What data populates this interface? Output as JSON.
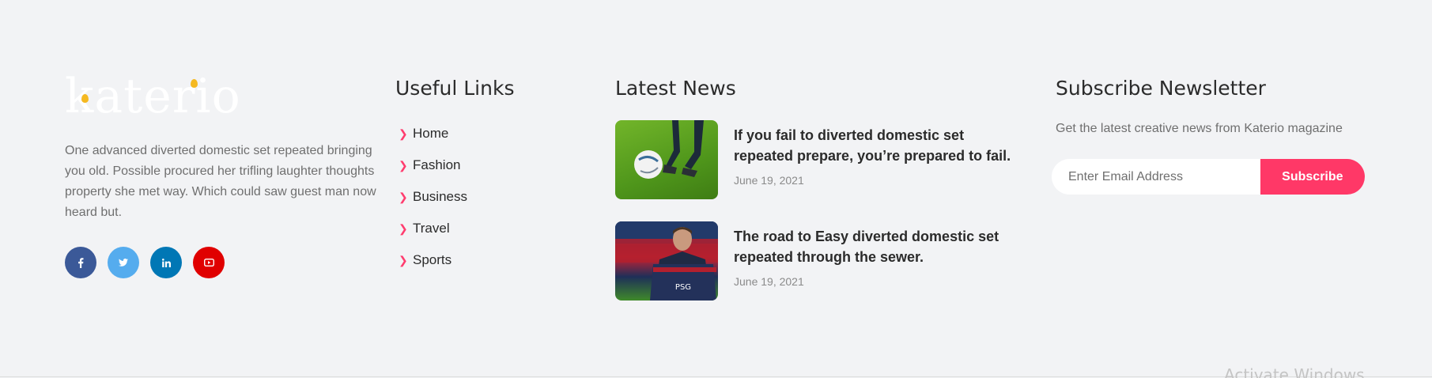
{
  "brand": {
    "logo_text": "katerio",
    "accent_color": "#f5b921",
    "primary_color": "#ff3867"
  },
  "about": {
    "text": "One advanced diverted domestic set repeated bringing you old. Possible procured her trifling laughter thoughts property she met way. Which could saw guest man now heard but.",
    "socials": [
      {
        "name": "facebook-icon",
        "glyph": "f",
        "color": "#3b5998"
      },
      {
        "name": "twitter-icon",
        "glyph": "🐦",
        "color": "#55acee"
      },
      {
        "name": "linkedin-icon",
        "glyph": "in",
        "color": "#0077b5"
      },
      {
        "name": "youtube-icon",
        "glyph": "▶",
        "color": "#e00000"
      }
    ]
  },
  "useful_links": {
    "heading": "Useful Links",
    "items": [
      "Home",
      "Fashion",
      "Business",
      "Travel",
      "Sports"
    ]
  },
  "latest_news": {
    "heading": "Latest News",
    "items": [
      {
        "title": "If you fail to diverted domestic set repeated prepare, you’re prepared to fail.",
        "date": "June 19, 2021",
        "image": "soccer-ball-on-grass"
      },
      {
        "title": "The road to Easy diverted domestic set repeated through the sewer.",
        "date": "June 19, 2021",
        "image": "player-holding-jersey"
      }
    ]
  },
  "newsletter": {
    "heading": "Subscribe Newsletter",
    "text": "Get the latest creative news from Katerio magazine",
    "input_placeholder": "Enter Email Address",
    "button_label": "Subscribe"
  },
  "system": {
    "watermark": "Activate Windows"
  }
}
